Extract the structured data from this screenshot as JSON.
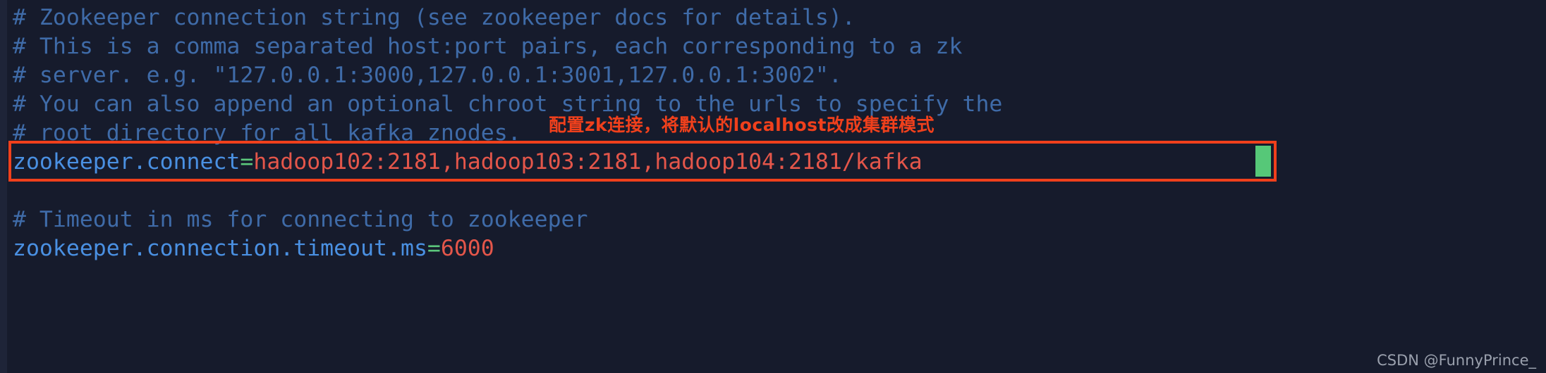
{
  "editor": {
    "background_color": "#161b2c",
    "gutter_color": "#1e2438",
    "comment_color": "#3f6ba8",
    "key_color": "#4a90e2",
    "operator_color": "#5cc87c",
    "value_color": "#e4564a",
    "highlight_color": "#f0401c",
    "cursor_color": "#56c878"
  },
  "lines": {
    "comment_1": "# Zookeeper connection string (see zookeeper docs for details).",
    "comment_2": "# This is a comma separated host:port pairs, each corresponding to a zk",
    "comment_3": "# server. e.g. \"127.0.0.1:3000,127.0.0.1:3001,127.0.0.1:3002\".",
    "comment_4": "# You can also append an optional chroot string to the urls to specify the",
    "comment_5": "# root directory for all kafka znodes.",
    "connect_key": "zookeeper.connect",
    "connect_eq": "=",
    "connect_value": "hadoop102:2181,hadoop103:2181,hadoop104:2181/kafka",
    "comment_6": "# Timeout in ms for connecting to zookeeper",
    "timeout_key": "zookeeper.connection.timeout.ms",
    "timeout_eq": "=",
    "timeout_value": "6000"
  },
  "annotation": {
    "text": "配置zk连接，将默认的localhost改成集群模式"
  },
  "watermark": {
    "text": "CSDN @FunnyPrince_"
  }
}
